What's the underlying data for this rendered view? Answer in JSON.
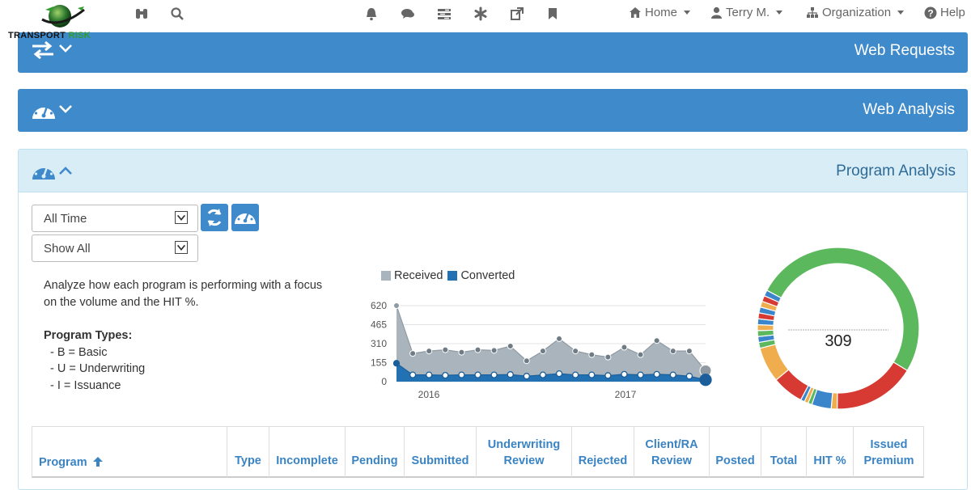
{
  "logo": {
    "word1": "TRANSPORT ",
    "word2": "RISK"
  },
  "nav": {
    "home": "Home",
    "user": "Terry M.",
    "organization": "Organization",
    "help": "Help"
  },
  "panels": {
    "web_requests": "Web Requests",
    "web_analysis": "Web Analysis",
    "program_analysis": "Program Analysis"
  },
  "filters": {
    "time_range": "All Time",
    "show": "Show All"
  },
  "description": {
    "line1": "Analyze how each program is performing with a focus",
    "line2": "on the volume and the HIT %.",
    "types_heading": "Program Types:",
    "type_b": "- B = Basic",
    "type_u": "- U = Underwriting",
    "type_i": "- I = Issuance"
  },
  "chart_data": [
    {
      "type": "area",
      "legend": [
        "Received",
        "Converted"
      ],
      "y_ticks": [
        0,
        155,
        310,
        465,
        620
      ],
      "ylim": [
        0,
        620
      ],
      "x_tick_labels": [
        "2016",
        "2017"
      ],
      "series": [
        {
          "name": "Received",
          "color": "#a9b4bd",
          "values": [
            620,
            230,
            250,
            260,
            240,
            260,
            255,
            290,
            170,
            250,
            350,
            250,
            220,
            200,
            280,
            220,
            335,
            250,
            250,
            90
          ]
        },
        {
          "name": "Converted",
          "color": "#2271b3",
          "values": [
            150,
            55,
            55,
            52,
            55,
            55,
            55,
            58,
            45,
            55,
            65,
            55,
            55,
            50,
            60,
            55,
            60,
            55,
            45,
            15
          ]
        }
      ]
    },
    {
      "type": "pie",
      "center_value": "309",
      "segments": [
        {
          "value": 130,
          "color": "#5cb85c"
        },
        {
          "value": 42,
          "color": "#d73a32"
        },
        {
          "value": 3,
          "color": "#f0ad4e"
        },
        {
          "value": 10,
          "color": "#3b86cb"
        },
        {
          "value": 2,
          "color": "#5cb85c"
        },
        {
          "value": 2,
          "color": "#f0ad4e"
        },
        {
          "value": 2,
          "color": "#3b86cb"
        },
        {
          "value": 16,
          "color": "#d73a32"
        },
        {
          "value": 18,
          "color": "#f0ad4e"
        },
        {
          "value": 3,
          "color": "#5cb85c"
        },
        {
          "value": 3,
          "color": "#3b86cb"
        },
        {
          "value": 3,
          "color": "#5cb85c"
        },
        {
          "value": 3,
          "color": "#f0ad4e"
        },
        {
          "value": 3,
          "color": "#3b86cb"
        },
        {
          "value": 3,
          "color": "#d73a32"
        },
        {
          "value": 3,
          "color": "#3b86cb"
        },
        {
          "value": 3,
          "color": "#f0ad4e"
        },
        {
          "value": 3,
          "color": "#d73a32"
        },
        {
          "value": 3,
          "color": "#3b86cb"
        }
      ]
    }
  ],
  "table": {
    "program": "Program",
    "type": "Type",
    "incomplete": "Incomplete",
    "pending": "Pending",
    "submitted": "Submitted",
    "underwriting_1": "Underwriting",
    "underwriting_2": "Review",
    "rejected": "Rejected",
    "client_1": "Client/RA",
    "client_2": "Review",
    "posted": "Posted",
    "total": "Total",
    "hit": "HIT %",
    "issued_1": "Issued",
    "issued_2": "Premium"
  },
  "colors": {
    "panel_blue": "#3f8acb",
    "panel_light": "#d9edf7",
    "link_blue": "#3a84c4"
  },
  "icons": [
    "globe-logo",
    "binoculars-icon",
    "search-icon",
    "bell-icon",
    "comments-icon",
    "tasks-icon",
    "asterisk-icon",
    "external-link-icon",
    "bookmark-icon",
    "home-icon",
    "user-icon",
    "sitemap-icon",
    "help-icon",
    "exchange-icon",
    "chevron-down-icon",
    "dashboard-icon",
    "chevron-up-icon",
    "refresh-icon",
    "sort-up-icon"
  ]
}
